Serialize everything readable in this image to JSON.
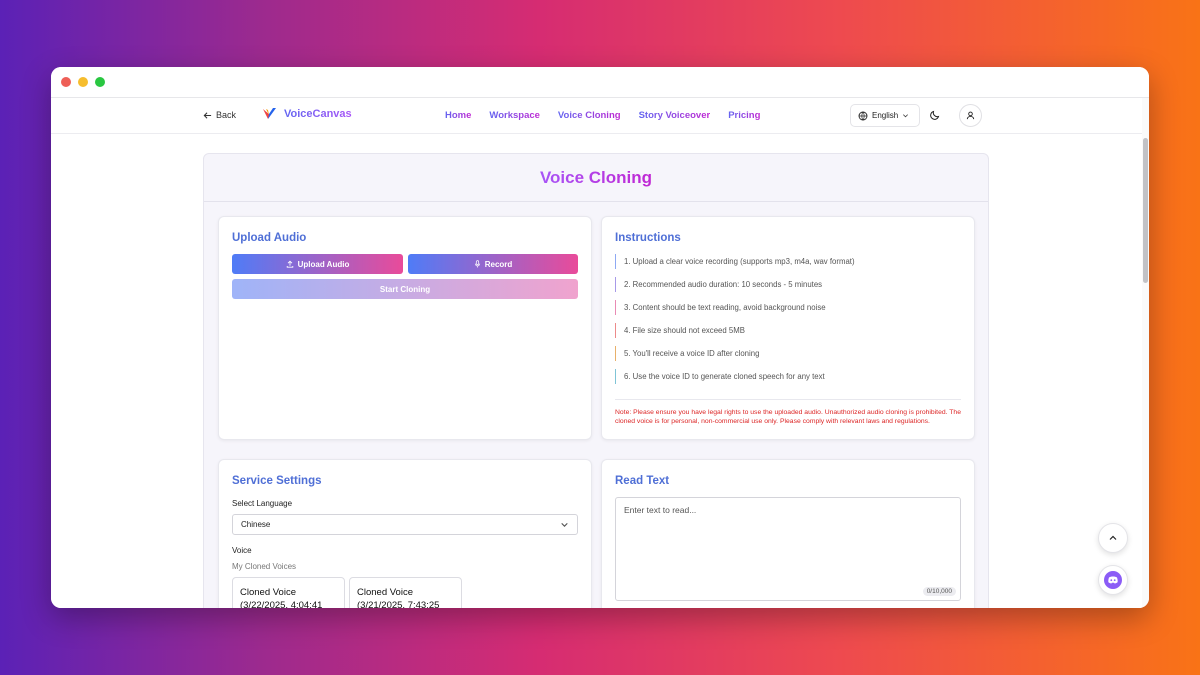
{
  "window": {
    "dots": [
      "#ee5f57",
      "#f6bd2e",
      "#29c741"
    ]
  },
  "nav": {
    "back_label": "Back",
    "brand": "VoiceCanvas",
    "links": [
      "Home",
      "Workspace",
      "Voice Cloning",
      "Story Voiceover",
      "Pricing"
    ],
    "language": "English"
  },
  "page": {
    "title": "Voice Cloning"
  },
  "upload": {
    "title": "Upload Audio",
    "upload_button": "Upload Audio",
    "record_button": "Record",
    "start_button": "Start Cloning"
  },
  "instructions": {
    "title": "Instructions",
    "items": [
      "1. Upload a clear voice recording (supports mp3, m4a, wav format)",
      "2. Recommended audio duration: 10 seconds - 5 minutes",
      "3. Content should be text reading, avoid background noise",
      "4. File size should not exceed 5MB",
      "5. You'll receive a voice ID after cloning",
      "6. Use the voice ID to generate cloned speech for any text"
    ],
    "item_colors": [
      "#8ea9f3",
      "#a79ae8",
      "#e98bb4",
      "#ec8a8a",
      "#e8b06a",
      "#7fc4d6"
    ],
    "note": "Note: Please ensure you have legal rights to use the uploaded audio. Unauthorized audio cloning is prohibited. The cloned voice is for personal, non-commercial use only. Please comply with relevant laws and regulations."
  },
  "settings": {
    "title": "Service Settings",
    "language_label": "Select Language",
    "language_value": "Chinese",
    "voice_label": "Voice",
    "cloned_label": "My Cloned Voices",
    "voices": [
      "Cloned Voice (3/22/2025, 4:04:41",
      "Cloned Voice (3/21/2025, 7:43:25"
    ]
  },
  "read_text": {
    "title": "Read Text",
    "placeholder": "Enter text to read...",
    "counter": "0/10,000"
  }
}
